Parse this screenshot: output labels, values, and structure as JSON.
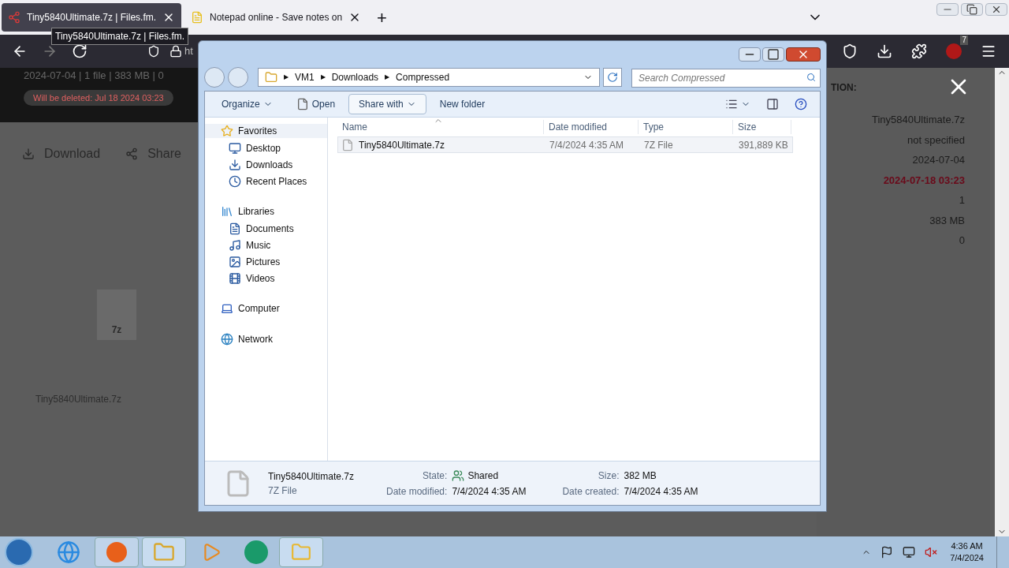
{
  "browser": {
    "tabs": [
      {
        "title": "Tiny5840Ultimate.7z | Files.fm.",
        "selected": true
      },
      {
        "title": "Notepad online - Save notes on",
        "selected": false
      }
    ],
    "new_tab": "+",
    "tooltip": "Tiny5840Ultimate.7z | Files.fm.",
    "address": "ht",
    "extension_badge": "7"
  },
  "page": {
    "summary": "2024-07-04 | 1 file | 383 MB | 0",
    "deletion_notice": "Will be deleted: Jul 18 2024 03:23",
    "actions": [
      "Download",
      "Share"
    ],
    "file_badge": "7z",
    "file_name": "Tiny5840Ultimate.7z",
    "info_heading": "TION:",
    "info_values": [
      {
        "text": "Tiny5840Ultimate.7z",
        "kind": "plain"
      },
      {
        "text": "not specified",
        "kind": "plain"
      },
      {
        "text": "2024-07-04",
        "kind": "plain"
      },
      {
        "text": "2024-07-18 03:23",
        "kind": "alert"
      },
      {
        "text": "1",
        "kind": "plain"
      },
      {
        "text": "383 MB",
        "kind": "plain"
      },
      {
        "text": "0",
        "kind": "plain"
      }
    ]
  },
  "explorer": {
    "breadcrumb": [
      "VM1",
      "Downloads",
      "Compressed"
    ],
    "breadcrumb_separator": "▶",
    "search_placeholder": "Search Compressed",
    "toolbar": [
      {
        "label": "Organize",
        "kind": "menu",
        "highlighted": false
      },
      {
        "label": "Open",
        "kind": "action",
        "highlighted": false
      },
      {
        "label": "Share with",
        "kind": "menu",
        "highlighted": true
      },
      {
        "label": "New folder",
        "kind": "plain",
        "highlighted": false
      }
    ],
    "navigation": [
      {
        "label": "Favorites",
        "selected": true,
        "children": [
          {
            "label": "Desktop",
            "selected": false
          },
          {
            "label": "Downloads",
            "selected": false
          },
          {
            "label": "Recent Places",
            "selected": false
          }
        ]
      },
      {
        "label": "Libraries",
        "selected": false,
        "children": [
          {
            "label": "Documents",
            "selected": false
          },
          {
            "label": "Music",
            "selected": false
          },
          {
            "label": "Pictures",
            "selected": false
          },
          {
            "label": "Videos",
            "selected": false
          }
        ]
      },
      {
        "label": "Computer",
        "selected": false
      },
      {
        "label": "Network",
        "selected": false
      }
    ],
    "columns": [
      "Name",
      "Date modified",
      "Type",
      "Size"
    ],
    "rows": [
      {
        "name": "Tiny5840Ultimate.7z",
        "date_modified": "7/4/2024 4:35 AM",
        "type": "7Z File",
        "size": "391,889 KB",
        "selected": true
      }
    ],
    "details": {
      "name": "Tiny5840Ultimate.7z",
      "type": "7Z File",
      "fields": [
        {
          "label": "State:",
          "value": "Shared"
        },
        {
          "label": "Size:",
          "value": "382 MB"
        },
        {
          "label": "Date modified:",
          "value": "7/4/2024 4:35 AM"
        },
        {
          "label": "Date created:",
          "value": "7/4/2024 4:35 AM"
        }
      ]
    }
  },
  "taskbar": {
    "time": "4:36 AM",
    "date": "7/4/2024"
  }
}
